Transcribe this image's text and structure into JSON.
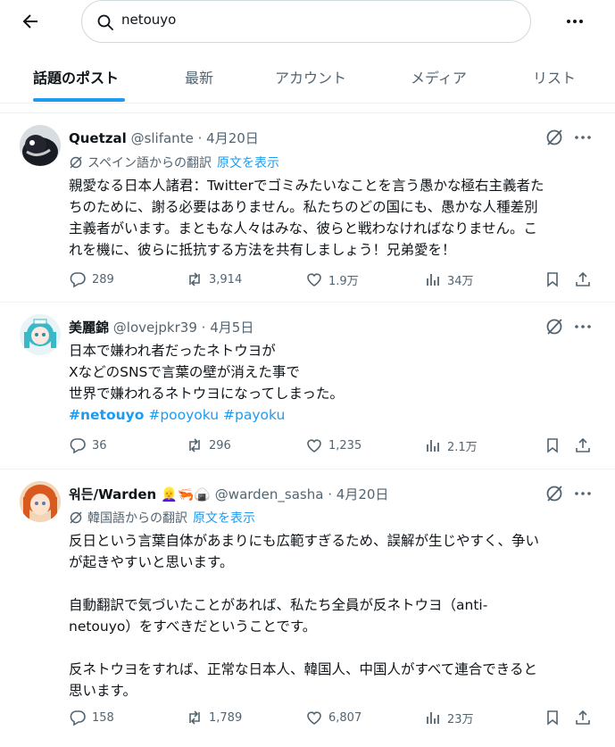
{
  "search": {
    "query": "netouyo"
  },
  "tabs": [
    {
      "label": "話題のポスト"
    },
    {
      "label": "最新"
    },
    {
      "label": "アカウント"
    },
    {
      "label": "メディア"
    },
    {
      "label": "リスト"
    }
  ],
  "posts": [
    {
      "name": "Quetzal",
      "handle": "@slifante",
      "date": "4月20日",
      "translation": "スペイン語からの翻訳",
      "show_original": "原文を表示",
      "lines": [
        "親愛なる日本人諸君：Twitterでゴミみたいなことを言う愚かな極右主義者た",
        "ちのために、謝る必要はありません。私たちのどの国にも、愚かな人種差別",
        "主義者がいます。まともな人々はみな、彼らと戦わなければなりません。こ",
        "れを機に、彼らに抵抗する方法を共有しましょう！兄弟愛を！"
      ],
      "replies": "289",
      "reposts": "3,914",
      "likes": "1.9万",
      "views": "34万"
    },
    {
      "name": "美麗錦",
      "handle": "@lovejpkr39",
      "date": "4月5日",
      "lines": [
        "日本で嫌われ者だったネトウヨが",
        "XなどのSNSで言葉の壁が消えた事で",
        "世界で嫌われるネトウヨになってしまった。"
      ],
      "hashtags": [
        "#netouyo",
        "#pooyoku",
        "#payoku"
      ],
      "replies": "36",
      "reposts": "296",
      "likes": "1,235",
      "views": "2.1万"
    },
    {
      "name": "워든/Warden",
      "emoji": "👱‍♀️🦐🍙",
      "handle": "@warden_sasha",
      "date": "4月20日",
      "translation": "韓国語からの翻訳",
      "show_original": "原文を表示",
      "lines": [
        "反日という言葉自体があまりにも広範すぎるため、誤解が生じやすく、争い",
        "が起きやすいと思います。",
        "",
        "自動翻訳で気づいたことがあれば、私たち全員が反ネトウヨ（anti-",
        "netouyo）をすべきだということです。",
        "",
        "反ネトウヨをすれば、正常な日本人、韓国人、中国人がすべて連合できると",
        "思います。"
      ],
      "replies": "158",
      "reposts": "1,789",
      "likes": "6,807",
      "views": "23万"
    }
  ]
}
